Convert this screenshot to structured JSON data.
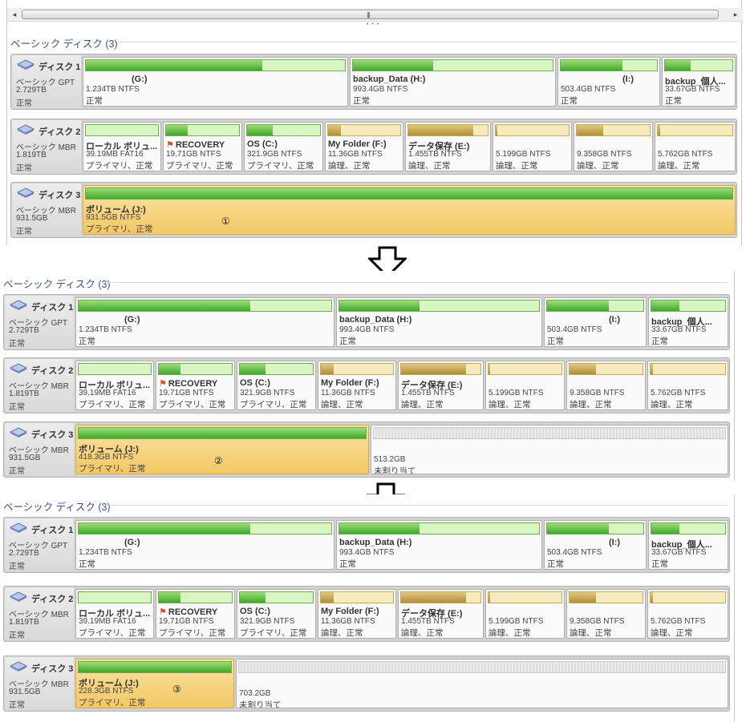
{
  "section_title": "ベーシック ディスク (3)",
  "disk_rows": [
    {
      "name": "ディスク 1",
      "type": "ベーシック GPT",
      "size": "2.729TB",
      "state": "正常",
      "partitions": [
        {
          "label": "(G:)",
          "detail": "1.234TB NTFS",
          "status": "正常",
          "usage": 0.68
        },
        {
          "label": "backup_Data (H:)",
          "detail": "993.4GB NTFS",
          "status": "正常",
          "usage": 0.4
        },
        {
          "label": "(I:)",
          "detail": "503.4GB NTFS",
          "status": "正常",
          "usage": 0.64
        },
        {
          "label": "backup_個人...",
          "detail": "33.67GB NTFS",
          "status": "正常",
          "usage": 0.38
        }
      ]
    },
    {
      "name": "ディスク 2",
      "type": "ベーシック MBR",
      "size": "1.819TB",
      "state": "正常",
      "partitions": [
        {
          "label": "ローカル ボリュ...",
          "detail": "39.19MB FAT16",
          "status": "プライマリ、正常",
          "usage": 0.0
        },
        {
          "label": "RECOVERY",
          "detail": "19.71GB NTFS",
          "status": "プライマリ、正常",
          "usage": 0.3,
          "flag": true
        },
        {
          "label": "OS (C:)",
          "detail": "321.9GB NTFS",
          "status": "プライマリ、正常",
          "usage": 0.35
        },
        {
          "label": "My Folder (F:)",
          "detail": "11.36GB NTFS",
          "status": "論理、正常",
          "usage": 0.18,
          "logical": true
        },
        {
          "label": "データ保存 (E:)",
          "detail": "1.455TB NTFS",
          "status": "論理、正常",
          "usage": 0.82,
          "logical": true
        },
        {
          "label": "",
          "detail": "5.199GB NTFS",
          "status": "論理、正常",
          "usage": 0.02,
          "logical": true
        },
        {
          "label": "",
          "detail": "9.358GB NTFS",
          "status": "論理、正常",
          "usage": 0.36,
          "logical": true
        },
        {
          "label": "",
          "detail": "5.762GB NTFS",
          "status": "論理、正常",
          "usage": 0.03,
          "logical": true
        }
      ]
    }
  ],
  "disk3": {
    "name": "ディスク 3",
    "type": "ベーシック MBR",
    "size": "931.5GB",
    "state": "正常"
  },
  "steps": [
    {
      "volume": {
        "label": "ボリューム (J:)",
        "detail": "931.5GB NTFS",
        "status": "プライマリ、正常",
        "usage": 1.0
      },
      "marker": "①"
    },
    {
      "volume": {
        "label": "ボリューム (J:)",
        "detail": "418.3GB NTFS",
        "status": "プライマリ、正常",
        "usage": 1.0
      },
      "marker": "②",
      "unallocated": {
        "size": "513.2GB",
        "label": "未割り当て"
      }
    },
    {
      "volume": {
        "label": "ボリューム (J:)",
        "detail": "228.3GB NTFS",
        "status": "プライマリ、正常",
        "usage": 1.0
      },
      "marker": "③",
      "unallocated": {
        "size": "703.2GB",
        "label": "未割り当て"
      }
    }
  ],
  "icons": {
    "disk": "disk-drive-icon",
    "arrow": "down-arrow-icon",
    "flag": "recovery-flag-icon"
  },
  "colors": {
    "primary_fill": "#3ea92a",
    "logical_fill": "#b18f35",
    "selected_bg": "#f3c865",
    "title": "#3b5282"
  }
}
